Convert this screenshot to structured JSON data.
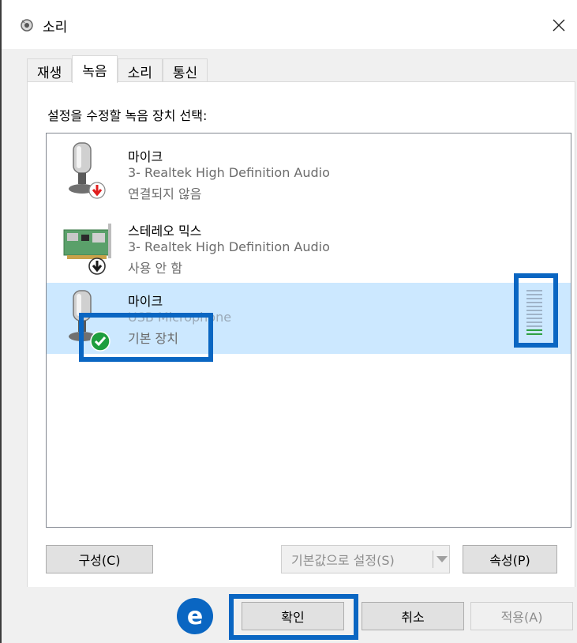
{
  "window": {
    "title": "소리",
    "close_icon": "close-icon",
    "tabs": [
      {
        "label": "재생",
        "active": false
      },
      {
        "label": "녹음",
        "active": true
      },
      {
        "label": "소리",
        "active": false
      },
      {
        "label": "통신",
        "active": false
      }
    ]
  },
  "recording": {
    "instruction": "설정을 수정할 녹음 장치 선택:",
    "devices": [
      {
        "name": "마이크",
        "driver": "3- Realtek High Definition Audio",
        "status": "연결되지 않음",
        "icon": "microphone-icon",
        "badge": "disconnected-arrow-icon",
        "badge_color": "#e01e1e",
        "selected": false
      },
      {
        "name": "스테레오 믹스",
        "driver": "3- Realtek High Definition Audio",
        "status": "사용 안 함",
        "icon": "sound-card-icon",
        "badge": "disabled-arrow-icon",
        "badge_color": "#1a1a1a",
        "selected": false
      },
      {
        "name": "마이크",
        "driver": "USB Microphone",
        "status": "기본 장치",
        "icon": "microphone-icon",
        "badge": "default-check-icon",
        "badge_color": "#1e9e3e",
        "selected": true
      }
    ],
    "level_meter": {
      "level_fraction": 0.12
    }
  },
  "buttons": {
    "configure": "구성(C)",
    "set_default": "기본값으로 설정(S)",
    "properties": "속성(P)",
    "ok": "확인",
    "cancel": "취소",
    "apply": "적용(A)"
  },
  "annotation": {
    "step_label": "e",
    "highlight_color": "#0a66c2"
  }
}
